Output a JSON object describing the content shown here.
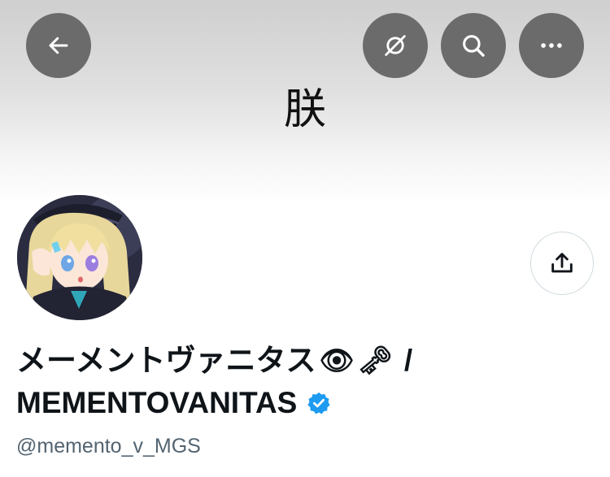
{
  "header": {
    "banner_text": "朕",
    "back_icon": "arrow-left-icon",
    "hide_icon": "eye-slash-icon",
    "search_icon": "search-icon",
    "more_icon": "more-horizontal-icon"
  },
  "profile": {
    "display_name_line1": "メーメントヴァニタス",
    "emoji_eye": "👁",
    "emoji_key": "🗝",
    "slash": "/",
    "display_name_line2": "MEMENTOVANITAS",
    "verified": "verified-badge-icon",
    "handle": "@memento_v_MGS"
  },
  "actions": {
    "share_icon": "share-icon"
  },
  "colors": {
    "button_bg": "#6b6b6b",
    "verified_blue": "#1d9bf0",
    "handle_gray": "#536471"
  }
}
